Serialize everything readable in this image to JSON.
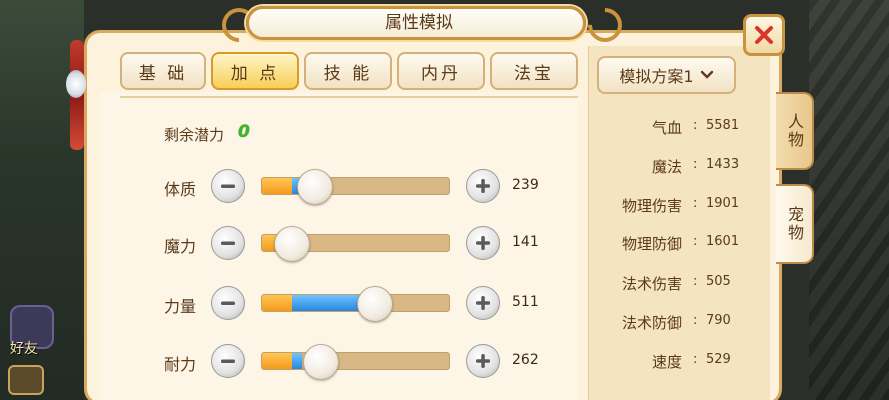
{
  "window": {
    "title": "属性模拟",
    "close_label": "close"
  },
  "tabs": [
    {
      "label": "基 础",
      "active": false
    },
    {
      "label": "加 点",
      "active": true
    },
    {
      "label": "技 能",
      "active": false
    },
    {
      "label": "内丹",
      "active": false
    },
    {
      "label": "法宝",
      "active": false
    }
  ],
  "scheme": {
    "label": "模拟方案1"
  },
  "side_tabs": [
    {
      "label": "人物",
      "active": false
    },
    {
      "label": "宠物",
      "active": true
    }
  ],
  "potential": {
    "label": "剩余潜力",
    "value": "0"
  },
  "attributes": [
    {
      "label": "体质",
      "value": "239",
      "orange_fraction": 0.16,
      "blue_fraction": 0.05,
      "knob_fraction": 0.28
    },
    {
      "label": "魔力",
      "value": "141",
      "orange_fraction": 0.16,
      "blue_fraction": 0.0,
      "knob_fraction": 0.16
    },
    {
      "label": "力量",
      "value": "511",
      "orange_fraction": 0.16,
      "blue_fraction": 0.43,
      "knob_fraction": 0.6
    },
    {
      "label": "耐力",
      "value": "262",
      "orange_fraction": 0.16,
      "blue_fraction": 0.05,
      "knob_fraction": 0.31
    }
  ],
  "stats": [
    {
      "label": "气血",
      "value": "5581"
    },
    {
      "label": "魔法",
      "value": "1433"
    },
    {
      "label": "物理伤害",
      "value": "1901"
    },
    {
      "label": "物理防御",
      "value": "1601"
    },
    {
      "label": "法术伤害",
      "value": "505"
    },
    {
      "label": "法术防御",
      "value": "790"
    },
    {
      "label": "速度",
      "value": "529"
    }
  ],
  "left_hud": {
    "badge_text": "好友"
  },
  "colors": {
    "accent_gold": "#d89a2b",
    "potential_green": "#3fb42b",
    "fill_orange": "#f59a1c",
    "fill_blue": "#2a86e0",
    "close_red": "#d9352a"
  }
}
